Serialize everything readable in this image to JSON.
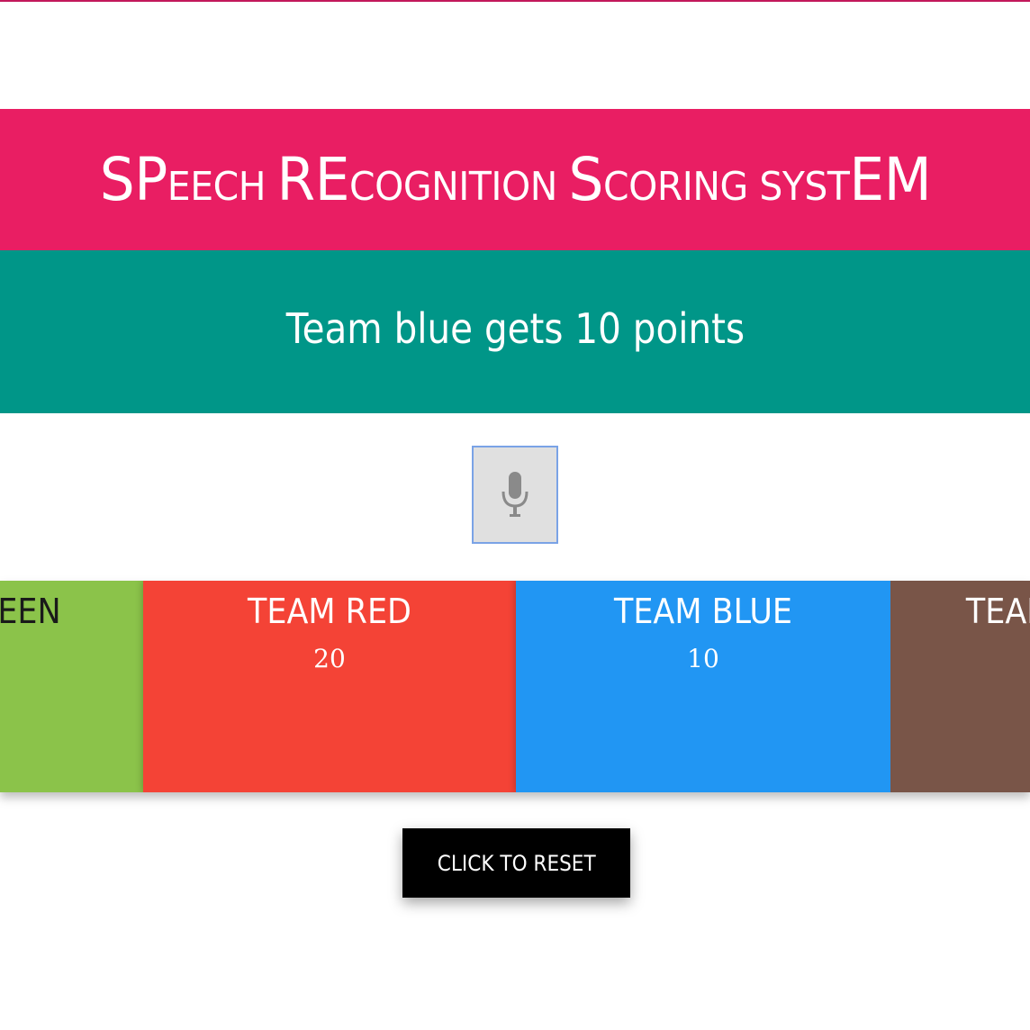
{
  "header": {
    "title_parts": [
      {
        "text": "SP",
        "big": true
      },
      {
        "text": "EECH ",
        "big": false
      },
      {
        "text": "RE",
        "big": true
      },
      {
        "text": "COGNITION ",
        "big": false
      },
      {
        "text": "S",
        "big": true
      },
      {
        "text": "CORING SYST",
        "big": false
      },
      {
        "text": "EM",
        "big": true
      }
    ]
  },
  "status": {
    "message": "Team blue gets 10 points"
  },
  "mic": {
    "icon": "microphone-icon"
  },
  "teams": [
    {
      "id": "green",
      "label": "TEAM GREEN",
      "score": "",
      "color": "#8bc34a"
    },
    {
      "id": "red",
      "label": "TEAM RED",
      "score": "20",
      "color": "#f44336"
    },
    {
      "id": "blue",
      "label": "TEAM BLUE",
      "score": "10",
      "color": "#2196f3"
    },
    {
      "id": "brown",
      "label": "TEAM BROWN",
      "score": "",
      "color": "#795548"
    }
  ],
  "reset": {
    "label": "CLICK TO RESET"
  },
  "colors": {
    "title_bar": "#e91e63",
    "status_bar": "#009688",
    "reset_button": "#000000"
  }
}
